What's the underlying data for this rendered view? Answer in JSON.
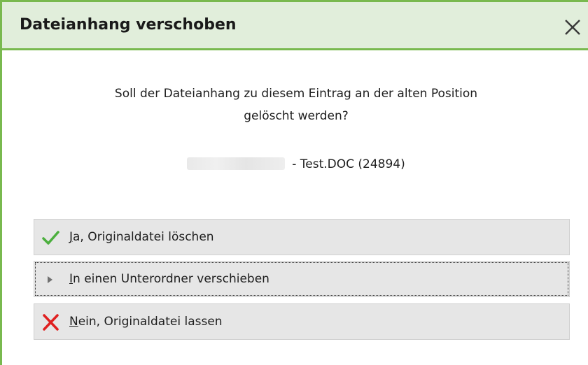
{
  "dialog": {
    "title": "Dateianhang verschoben",
    "message_line1": "Soll der Dateianhang zu diesem Eintrag an der alten Position",
    "message_line2": "gelöscht werden?",
    "file_info": "- Test.DOC (24894)"
  },
  "options": {
    "yes": {
      "mnemonic": "J",
      "rest": "a, Originaldatei löschen",
      "icon": "checkmark-icon"
    },
    "move": {
      "mnemonic": "I",
      "rest": "n einen Unterordner verschieben",
      "icon": "triangle-right-icon"
    },
    "no": {
      "mnemonic": "N",
      "rest": "ein, Originaldatei lassen",
      "icon": "red-x-icon"
    }
  },
  "colors": {
    "border_green": "#79b94f",
    "title_bg": "#e1eedb",
    "option_bg": "#e6e6e6",
    "check_green": "#4caf3e",
    "x_red": "#e02020"
  }
}
